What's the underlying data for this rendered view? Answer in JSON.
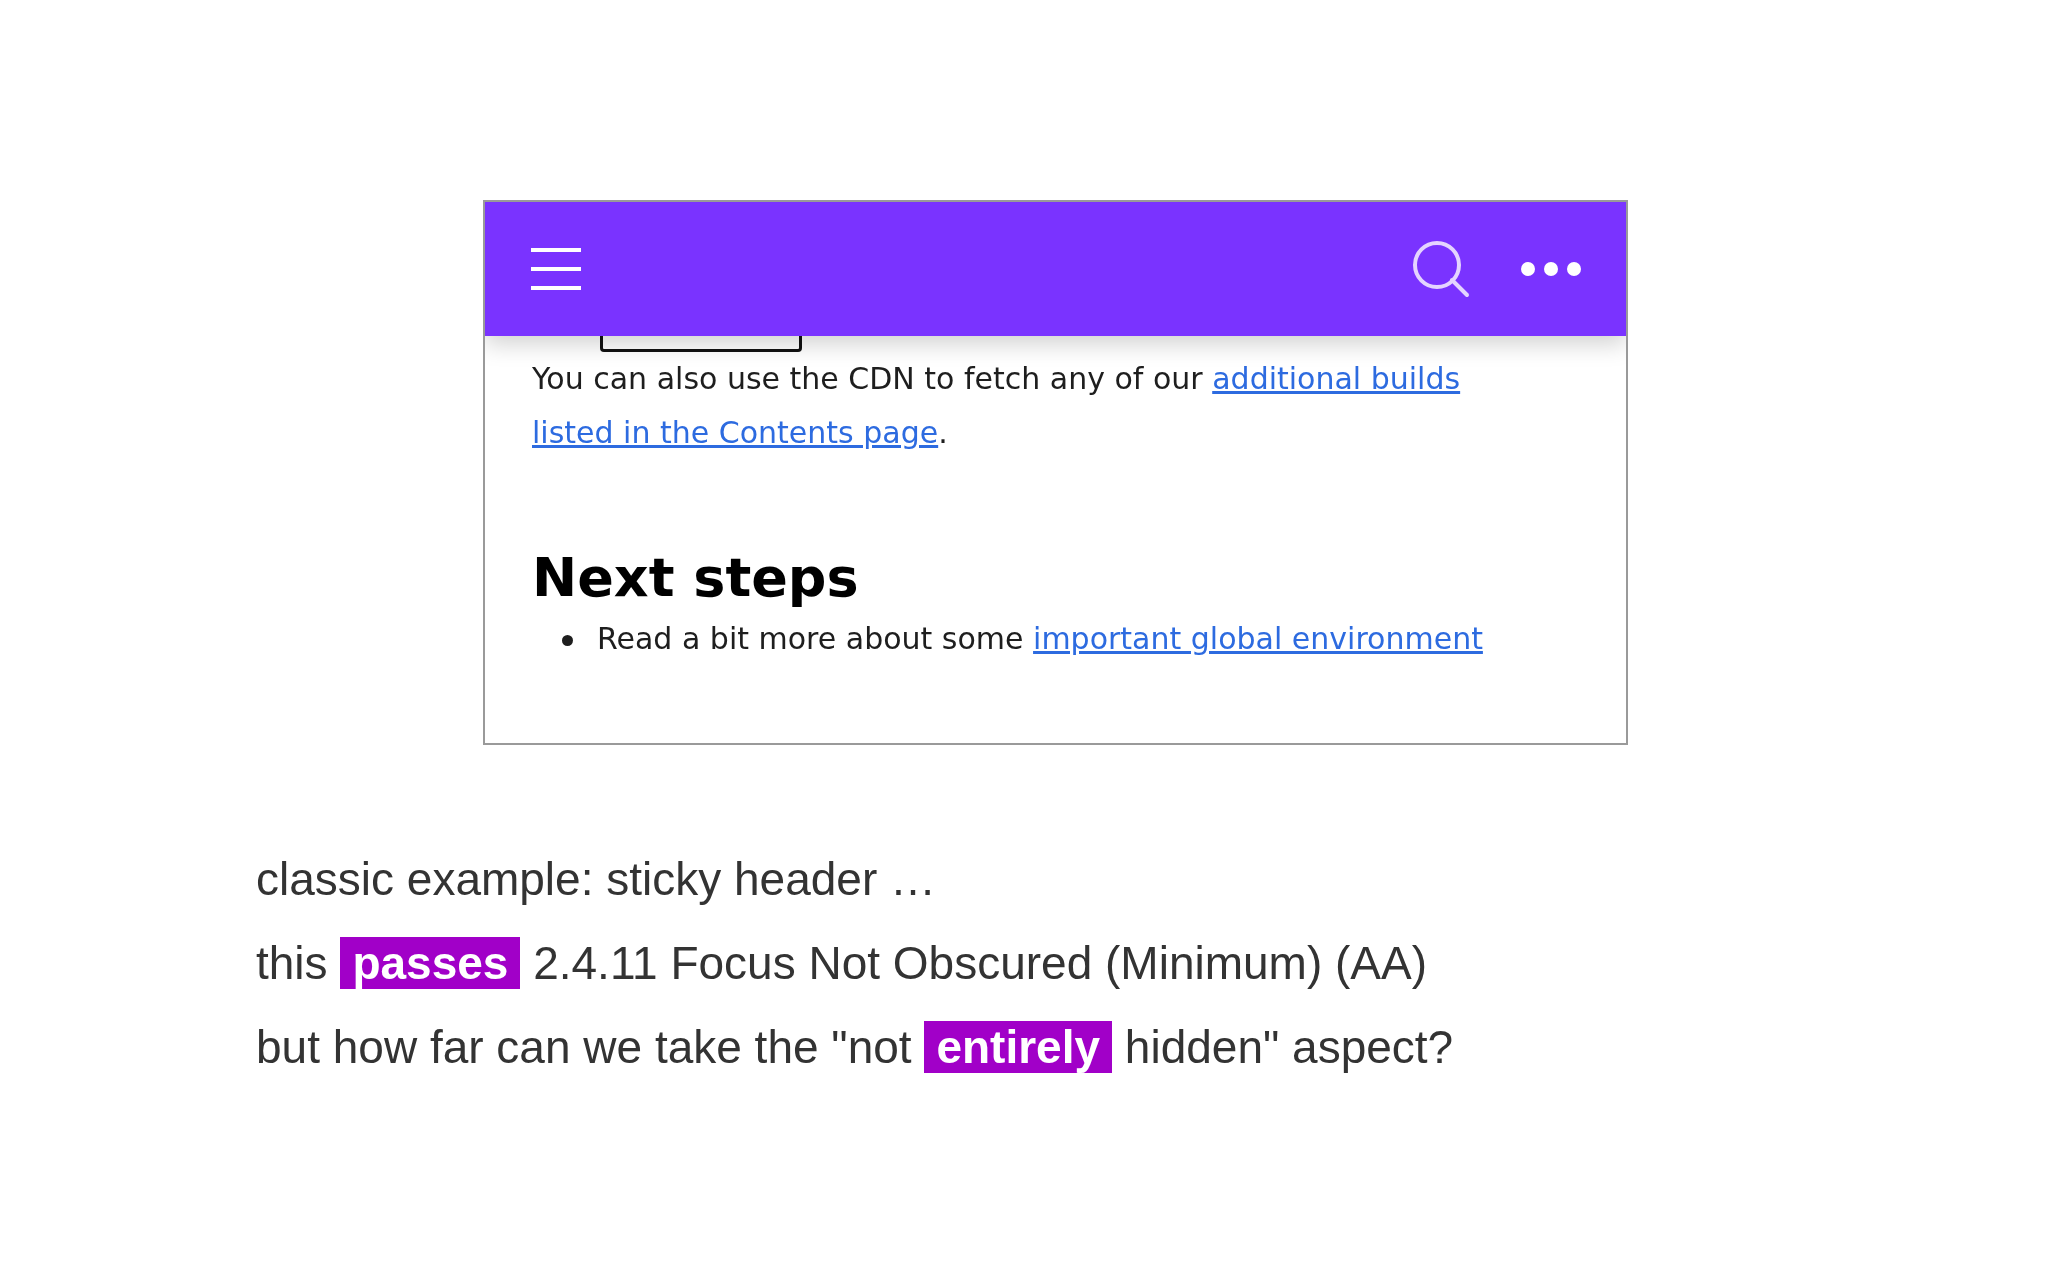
{
  "screenshot": {
    "paragraph": [
      [
        {
          "kind": "text",
          "text": "You can also use the CDN to fetch any of our "
        },
        {
          "kind": "link",
          "text": "additional builds"
        }
      ],
      [
        {
          "kind": "link",
          "text": "listed in the Contents page"
        },
        {
          "kind": "text",
          "text": "."
        }
      ]
    ],
    "heading": "Next steps",
    "bullets": [
      [
        {
          "kind": "text",
          "text": "Read a bit more about some "
        },
        {
          "kind": "link",
          "text": "important global environment"
        }
      ]
    ]
  },
  "notes": [
    "classic example: sticky header …",
    "this **passes** 2.4.11 Focus Not Obscured (Minimum) (AA)",
    "but how far can we take the \"not **entirely** hidden\" aspect?"
  ]
}
